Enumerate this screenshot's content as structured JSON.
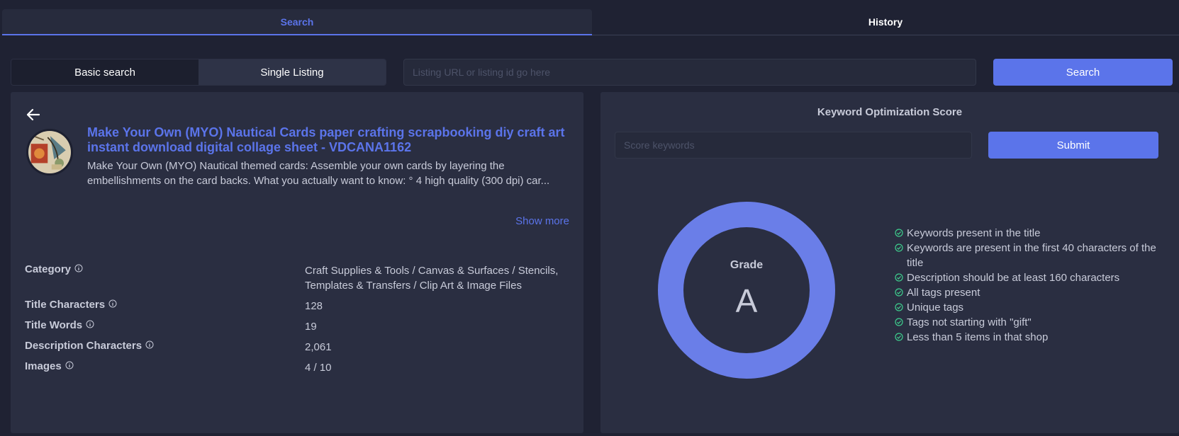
{
  "tabs": {
    "search": "Search",
    "history": "History"
  },
  "search_bar": {
    "basic_label": "Basic search",
    "single_label": "Single Listing",
    "url_placeholder": "Listing URL or listing id go here",
    "search_label": "Search"
  },
  "listing": {
    "title": "Make Your Own (MYO) Nautical Cards paper crafting scrapbooking diy craft art instant download digital collage sheet - VDCANA1162",
    "description": "Make Your Own (MYO) Nautical themed cards: Assemble your own cards by layering the embellishments on the card backs. What you actually want to know: ° 4 high quality (300 dpi) car...",
    "show_more": "Show more"
  },
  "stats": [
    {
      "label": "Category",
      "value": "Craft Supplies & Tools / Canvas & Surfaces / Stencils, Templates & Transfers / Clip Art & Image Files"
    },
    {
      "label": "Title Characters",
      "value": "128"
    },
    {
      "label": "Title Words",
      "value": "19"
    },
    {
      "label": "Description Characters",
      "value": "2,061"
    },
    {
      "label": "Images",
      "value": "4 / 10"
    }
  ],
  "score": {
    "title": "Keyword Optimization Score",
    "placeholder": "Score keywords",
    "submit_label": "Submit",
    "grade_label": "Grade",
    "grade": "A",
    "checks": [
      "Keywords present in the title",
      "Keywords are present in the first 40 characters of the title",
      "Description should be at least 160 characters",
      "All tags present",
      "Unique tags",
      "Tags not starting with \"gift\"",
      "Less than 5 items in that shop"
    ]
  },
  "colors": {
    "accent": "#5b74ea",
    "donut": "#6a7ee8",
    "check": "#3ecf8e",
    "background": "#1f2233",
    "panel": "#2a2e41"
  },
  "icons": {
    "back": "arrow-left-icon",
    "info": "info-circle-icon",
    "check": "check-circle-icon"
  }
}
